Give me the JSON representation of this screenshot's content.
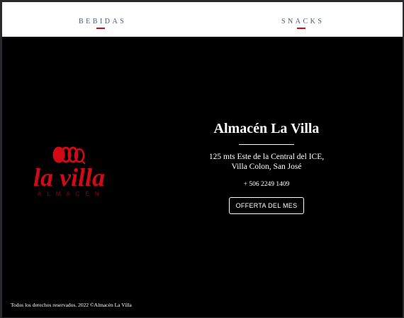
{
  "nav": {
    "items": [
      {
        "label": "BEBIDAS"
      },
      {
        "label": "SNACKS"
      }
    ],
    "accent_color": "#d10a16"
  },
  "logo": {
    "wordmark": "la villa",
    "subtitle": "ALMACÉN",
    "color": "#d10a16"
  },
  "store": {
    "name": "Almacén La Villa",
    "address_line1": "125 mts Este de la Central del ICE,",
    "address_line2": "Villa Colon, San José",
    "phone": "+ 506 2249 1409",
    "offer_button_label": "OFFERTA DEL MES"
  },
  "footer": {
    "copyright": "Todos los derechos reservados. 2022 ©Almacén La Villa"
  }
}
